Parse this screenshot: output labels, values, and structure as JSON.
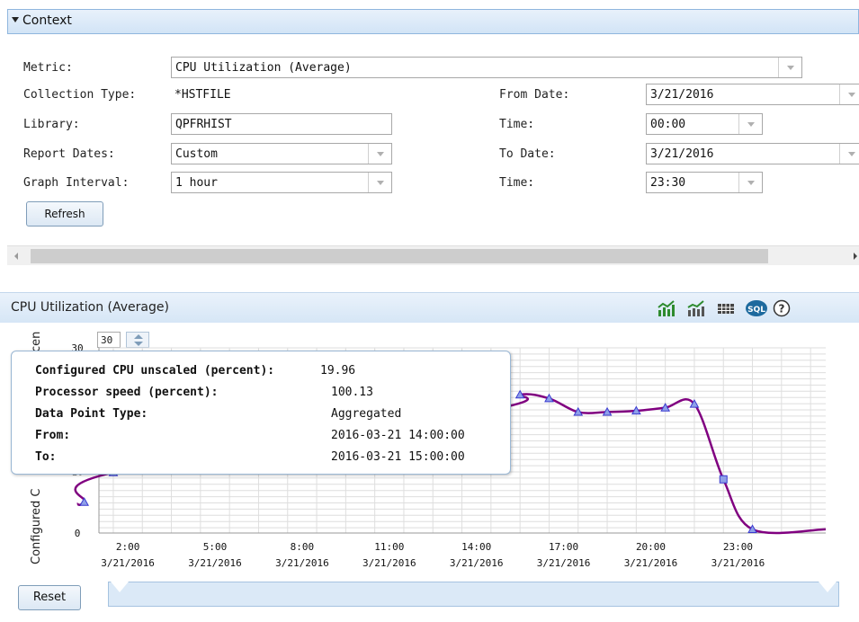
{
  "context": {
    "title": "Context",
    "metric_label": "Metric:",
    "metric_value": "CPU Utilization (Average)",
    "collection_type_label": "Collection Type:",
    "collection_type_value": "*HSTFILE",
    "library_label": "Library:",
    "library_value": "QPFRHIST",
    "report_dates_label": "Report Dates:",
    "report_dates_value": "Custom",
    "graph_interval_label": "Graph Interval:",
    "graph_interval_value": "1 hour",
    "from_date_label": "From Date:",
    "from_date_value": "3/21/2016",
    "from_time_label": "Time:",
    "from_time_value": "00:00",
    "to_date_label": "To Date:",
    "to_date_value": "3/21/2016",
    "to_time_label": "Time:",
    "to_time_value": "23:30",
    "refresh_label": "Refresh"
  },
  "chart_panel": {
    "title": "CPU Utilization (Average)",
    "icons": [
      "line-chart-icon",
      "area-chart-icon",
      "table-view-icon",
      "sql-icon",
      "help-icon"
    ],
    "sql_label": "SQL",
    "help_label": "?",
    "scale_value": "30",
    "reset_label": "Reset",
    "tooltip": {
      "row1_key": "Configured CPU unscaled (percent):",
      "row1_val": "19.96",
      "row2_key": "Processor speed (percent):",
      "row2_val": "100.13",
      "row3_key": "Data Point Type:",
      "row3_val": "Aggregated",
      "row4_key": "From:",
      "row4_val": "2016-03-21 14:00:00",
      "row5_key": "To:",
      "row5_val": "2016-03-21 15:00:00"
    }
  },
  "chart_data": {
    "type": "line",
    "ylabel": "Configured C",
    "ylabel_cut": "cen",
    "ylim": [
      0,
      30
    ],
    "ytick_labels": [
      "0",
      "10",
      "20",
      "30"
    ],
    "xtick_labels": [
      {
        "time": "2:00",
        "date": "3/21/2016"
      },
      {
        "time": "5:00",
        "date": "3/21/2016"
      },
      {
        "time": "8:00",
        "date": "3/21/2016"
      },
      {
        "time": "11:00",
        "date": "3/21/2016"
      },
      {
        "time": "14:00",
        "date": "3/21/2016"
      },
      {
        "time": "17:00",
        "date": "3/21/2016"
      },
      {
        "time": "20:00",
        "date": "3/21/2016"
      },
      {
        "time": "23:00",
        "date": "3/21/2016"
      }
    ],
    "xtick_hours": [
      2,
      5,
      8,
      11,
      14,
      17,
      20,
      23
    ],
    "x_hours": [
      0.5,
      1.5,
      14.5,
      15.5,
      16.5,
      17.5,
      18.5,
      19.5,
      20.5,
      21.5,
      22.5,
      23.5
    ],
    "y": [
      5.0,
      9.8,
      19.96,
      22.4,
      21.8,
      19.6,
      19.6,
      19.8,
      20.3,
      20.9,
      8.7,
      0.6
    ],
    "grid": true,
    "line_color": "#800080",
    "marker_color": "#3a3ad0",
    "highlight_index": 2
  }
}
